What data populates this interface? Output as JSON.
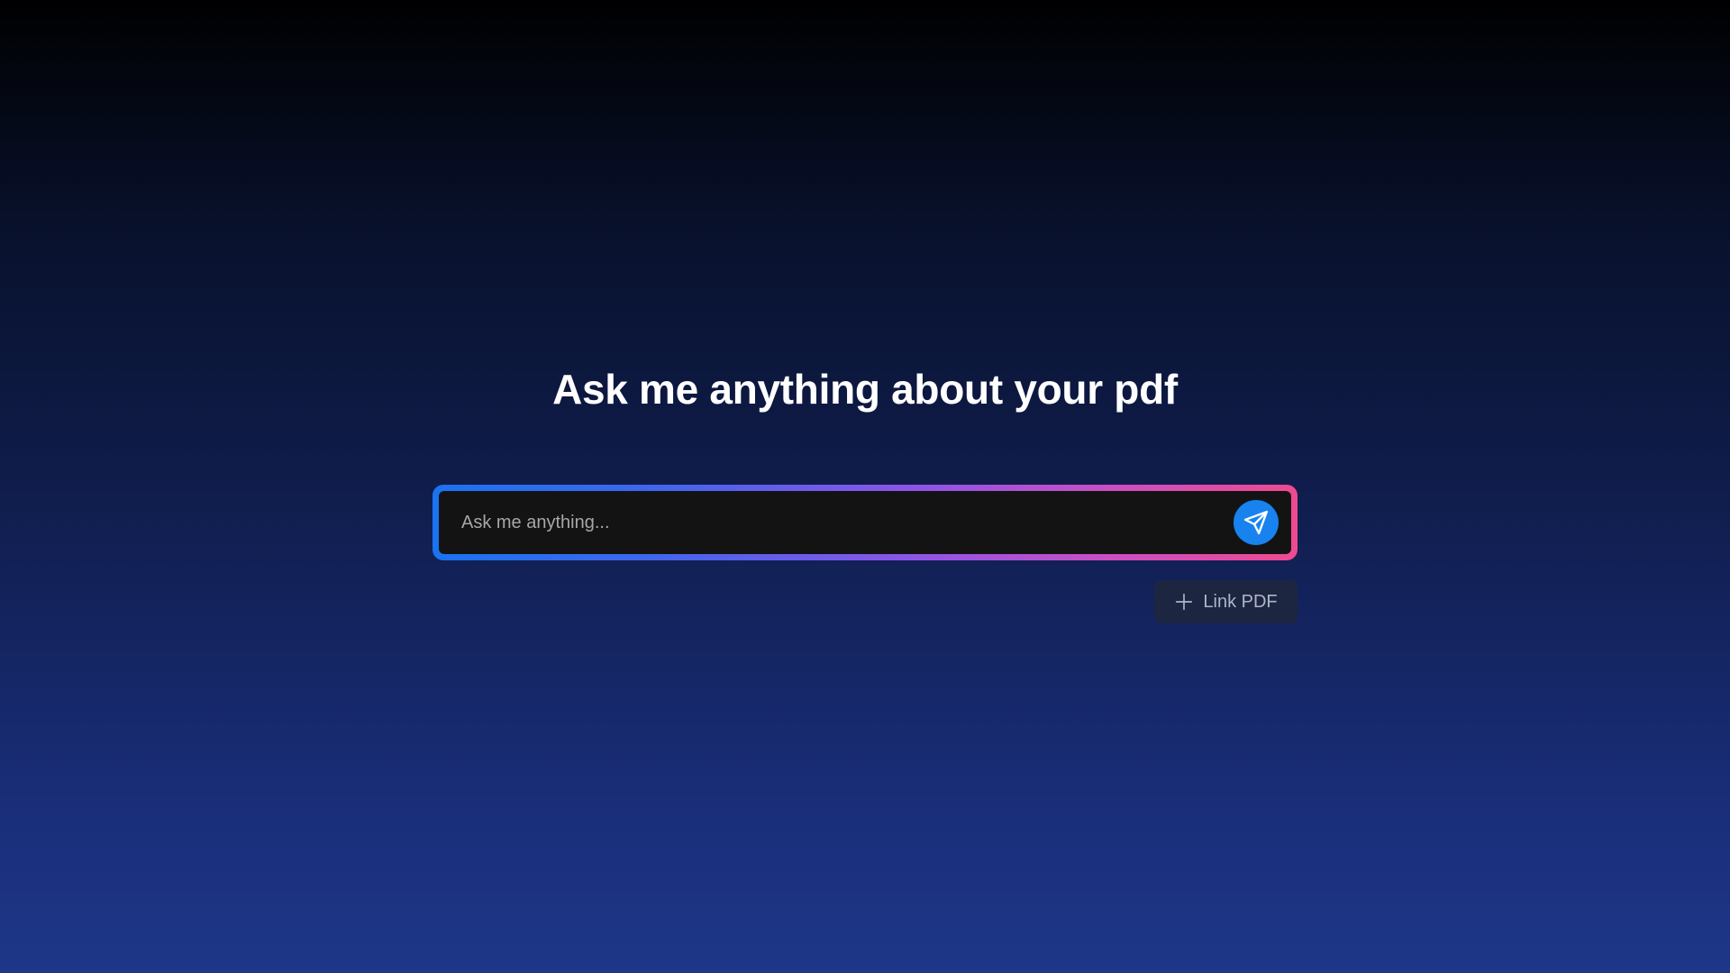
{
  "hero": {
    "title": "Ask me anything about your pdf"
  },
  "chat": {
    "placeholder": "Ask me anything...",
    "value": "",
    "send_icon": "send-icon",
    "send_color": "#1883ee",
    "frame_gradient": [
      "#1a73f0",
      "#8b55e8",
      "#ef4a8f"
    ]
  },
  "actions": {
    "link_pdf_label": "Link PDF",
    "link_pdf_icon": "plus-icon"
  }
}
